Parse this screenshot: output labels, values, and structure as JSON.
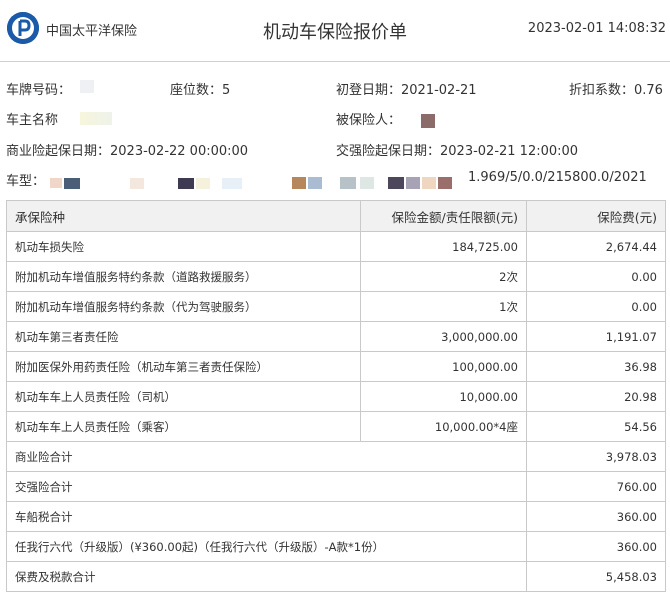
{
  "header": {
    "company": "中国太平洋保险",
    "title": "机动车保险报价单",
    "datetime": "2023-02-01 14:08:32"
  },
  "info": {
    "plate_label": "车牌号码：",
    "seats": "座位数：5",
    "first_reg": "初登日期：2021-02-21",
    "discount": "折扣系数：0.76",
    "owner_label": "车主名称",
    "insured_label": "被保险人：",
    "commercial_start": "商业险起保日期：2023-02-22 00:00:00",
    "compulsory_start": "交强险起保日期：2023-02-21 12:00:00",
    "model_label": "车型：",
    "model_suffix": "1.969/5/0.0/215800.0/2021"
  },
  "table": {
    "headers": [
      "承保险种",
      "保险金额/责任限额(元)",
      "保险费(元)"
    ],
    "rows": [
      {
        "name": "机动车损失险",
        "amount": "184,725.00",
        "premium": "2,674.44"
      },
      {
        "name": "附加机动车增值服务特约条款（道路救援服务）",
        "amount": "2次",
        "premium": "0.00"
      },
      {
        "name": "附加机动车增值服务特约条款（代为驾驶服务）",
        "amount": "1次",
        "premium": "0.00"
      },
      {
        "name": "机动车第三者责任险",
        "amount": "3,000,000.00",
        "premium": "1,191.07"
      },
      {
        "name": "附加医保外用药责任险（机动车第三者责任保险）",
        "amount": "100,000.00",
        "premium": "36.98"
      },
      {
        "name": "机动车车上人员责任险（司机）",
        "amount": "10,000.00",
        "premium": "20.98"
      },
      {
        "name": "机动车车上人员责任险（乘客）",
        "amount": "10,000.00*4座",
        "premium": "54.56"
      }
    ],
    "summary": [
      {
        "name": "商业险合计",
        "premium": "3,978.03"
      },
      {
        "name": "交强险合计",
        "premium": "760.00"
      },
      {
        "name": "车船税合计",
        "premium": "360.00"
      },
      {
        "name": "任我行六代（升级版）(¥360.00起)（任我行六代（升级版）-A款*1份）",
        "premium": "360.00"
      },
      {
        "name": "保费及税款合计",
        "premium": "5,458.03"
      }
    ]
  },
  "colors": {
    "brand": "#1b5aa8"
  }
}
